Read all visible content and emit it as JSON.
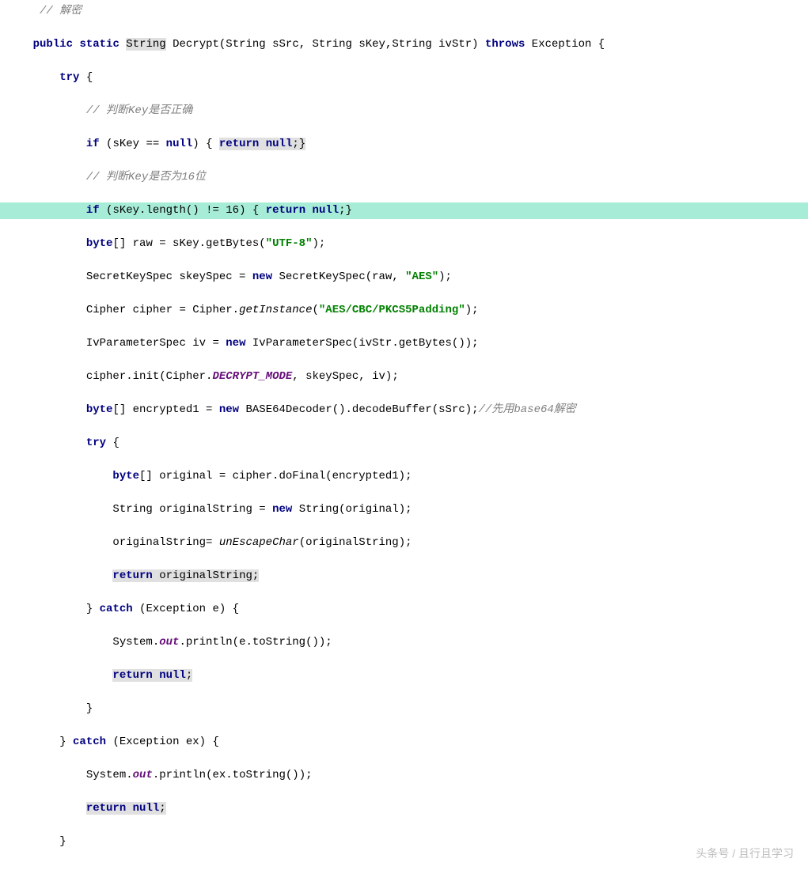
{
  "code": {
    "l1": "// 解密",
    "l2a": "public",
    "l2b": "static",
    "l2c": "String",
    "l2d": "Decrypt(String sSrc, String sKey,String ivStr)",
    "l2e": "throws",
    "l2f": "Exception {",
    "l3a": "try",
    "l3b": "{",
    "l4": "// 判断Key是否正确",
    "l5a": "if",
    "l5b": "(sKey ==",
    "l5c": "null",
    "l5d": ") {",
    "l5e": "return",
    "l5f": "null",
    "l5g": ";}",
    "l6": "// 判断Key是否为16位",
    "l7a": "if",
    "l7b": "(sKey.length() !=",
    "l7c": "16",
    "l7d": ") {",
    "l7e": "return",
    "l7f": "null",
    "l7g": ";}",
    "l8a": "byte",
    "l8b": "[] raw = sKey.getBytes(",
    "l8c": "\"UTF-8\"",
    "l8d": ");",
    "l9a": "SecretKeySpec skeySpec =",
    "l9b": "new",
    "l9c": "SecretKeySpec(raw,",
    "l9d": "\"AES\"",
    "l9e": ");",
    "l10a": "Cipher cipher = Cipher.",
    "l10b": "getInstance",
    "l10c": "(",
    "l10d": "\"AES/CBC/PKCS5Padding\"",
    "l10e": ");",
    "l11a": "IvParameterSpec iv =",
    "l11b": "new",
    "l11c": "IvParameterSpec(ivStr.getBytes());",
    "l12a": "cipher.init(Cipher.",
    "l12b": "DECRYPT_MODE",
    "l12c": ", skeySpec, iv);",
    "l13a": "byte",
    "l13b": "[] encrypted1 =",
    "l13c": "new",
    "l13d": "BASE64Decoder().decodeBuffer(sSrc);",
    "l13e": "//先用base64解密",
    "l14a": "try",
    "l14b": "{",
    "l15a": "byte",
    "l15b": "[] original = cipher.doFinal(encrypted1);",
    "l16a": "String originalString =",
    "l16b": "new",
    "l16c": "String(original);",
    "l17a": "originalString=",
    "l17b": "unEscapeChar",
    "l17c": "(originalString);",
    "l18a": "return",
    "l18b": "originalString;",
    "l19a": "}",
    "l19b": "catch",
    "l19c": "(Exception e) {",
    "l20a": "System.",
    "l20b": "out",
    "l20c": ".println(e.toString());",
    "l21a": "return",
    "l21b": "null",
    "l21c": ";",
    "l22": "}",
    "l23a": "}",
    "l23b": "catch",
    "l23c": "(Exception ex) {",
    "l24a": "System.",
    "l24b": "out",
    "l24c": ".println(ex.toString());",
    "l25a": "return",
    "l25b": "null",
    "l25c": ";",
    "l26": "}"
  },
  "watermark": "头条号 / 且行且学习"
}
